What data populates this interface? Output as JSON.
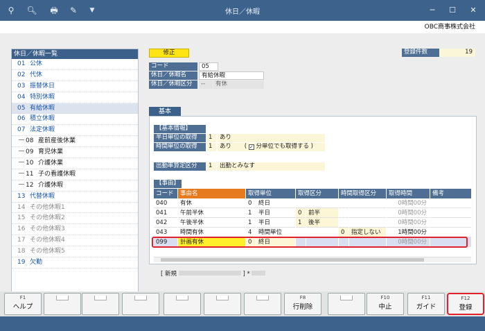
{
  "window": {
    "title": "休日／休暇",
    "company": "OBC商事株式会社"
  },
  "left_list": {
    "header": "休日／休暇一覧",
    "items": [
      {
        "code": "01",
        "name": "公休",
        "type": "main"
      },
      {
        "code": "02",
        "name": "代休",
        "type": "main"
      },
      {
        "code": "03",
        "name": "振替休日",
        "type": "main"
      },
      {
        "code": "04",
        "name": "特別休暇",
        "type": "main"
      },
      {
        "code": "05",
        "name": "有給休暇",
        "type": "main",
        "selected": true
      },
      {
        "code": "06",
        "name": "積立休暇",
        "type": "main"
      },
      {
        "code": "07",
        "name": "法定休暇",
        "type": "main"
      },
      {
        "code": "08",
        "name": "産前産後休業",
        "type": "sub"
      },
      {
        "code": "09",
        "name": "育児休業",
        "type": "sub"
      },
      {
        "code": "10",
        "name": "介護休業",
        "type": "sub"
      },
      {
        "code": "11",
        "name": "子の看護休暇",
        "type": "sub"
      },
      {
        "code": "12",
        "name": "介護休暇",
        "type": "sub"
      },
      {
        "code": "13",
        "name": "代替休暇",
        "type": "main"
      },
      {
        "code": "14",
        "name": "その他休暇1",
        "type": "gray"
      },
      {
        "code": "15",
        "name": "その他休暇2",
        "type": "gray"
      },
      {
        "code": "16",
        "name": "その他休暇3",
        "type": "gray"
      },
      {
        "code": "17",
        "name": "その他休暇4",
        "type": "gray"
      },
      {
        "code": "18",
        "name": "その他休暇5",
        "type": "gray"
      },
      {
        "code": "19",
        "name": "欠勤",
        "type": "main"
      }
    ]
  },
  "mode_badge": "修正",
  "record_count": {
    "label": "登録件数",
    "value": "19"
  },
  "form": {
    "code_label": "コード",
    "code_value": "05",
    "name_label": "休日／休暇名",
    "name_value": "有給休暇",
    "cat_label": "休日／休暇区分",
    "cat_code": "--",
    "cat_value": "有休"
  },
  "tab_label": "基本",
  "basic": {
    "header": "【基本情報】",
    "half_day_label": "半日単位の取得",
    "half_day_code": "1",
    "half_day_value": "あり",
    "hourly_label": "時間単位の取得",
    "hourly_code": "1",
    "hourly_value": "あり",
    "minute_option": "分単位でも取得する",
    "attendance_label": "出勤率算定区分",
    "attendance_code": "1",
    "attendance_value": "出勤とみなす"
  },
  "reasons": {
    "header": "【事由】",
    "columns": [
      "コード",
      "事由名",
      "取得単位",
      "取得区分",
      "時間取得区分",
      "取得時間",
      "備考"
    ],
    "rows": [
      {
        "code": "040",
        "name": "有休",
        "unit_code": "0",
        "unit": "終日",
        "div_code": "",
        "div": "",
        "tdiv_code": "",
        "tdiv": "",
        "time": "0時間00分"
      },
      {
        "code": "041",
        "name": "午前半休",
        "unit_code": "1",
        "unit": "半日",
        "div_code": "0",
        "div": "前半",
        "tdiv_code": "",
        "tdiv": "",
        "time": "0時間00分"
      },
      {
        "code": "042",
        "name": "午後半休",
        "unit_code": "1",
        "unit": "半日",
        "div_code": "1",
        "div": "後半",
        "tdiv_code": "",
        "tdiv": "",
        "time": "0時間00分"
      },
      {
        "code": "043",
        "name": "時間有休",
        "unit_code": "4",
        "unit": "時間単位",
        "div_code": "",
        "div": "",
        "tdiv_code": "0",
        "tdiv": "指定しない",
        "time": "1時間00分"
      },
      {
        "code": "099",
        "name": "計画有休",
        "unit_code": "0",
        "unit": "終日",
        "div_code": "",
        "div": "",
        "tdiv_code": "",
        "tdiv": "",
        "time": "0時間00分"
      }
    ]
  },
  "footer_status": {
    "prefix": "[ 新規",
    "suffix": "] *"
  },
  "fkeys": [
    {
      "fn": "F1",
      "label": "ヘルプ"
    },
    {
      "fn": "",
      "label": ""
    },
    {
      "fn": "",
      "label": ""
    },
    {
      "fn": "",
      "label": ""
    },
    {
      "fn": "",
      "label": ""
    },
    {
      "fn": "",
      "label": ""
    },
    {
      "fn": "",
      "label": ""
    },
    {
      "fn": "F8",
      "label": "行削除"
    },
    {
      "fn": "",
      "label": ""
    },
    {
      "fn": "F10",
      "label": "中止"
    },
    {
      "fn": "F11",
      "label": "ガイド"
    },
    {
      "fn": "F12",
      "label": "登録"
    }
  ],
  "highlight_color": "#e0202a"
}
